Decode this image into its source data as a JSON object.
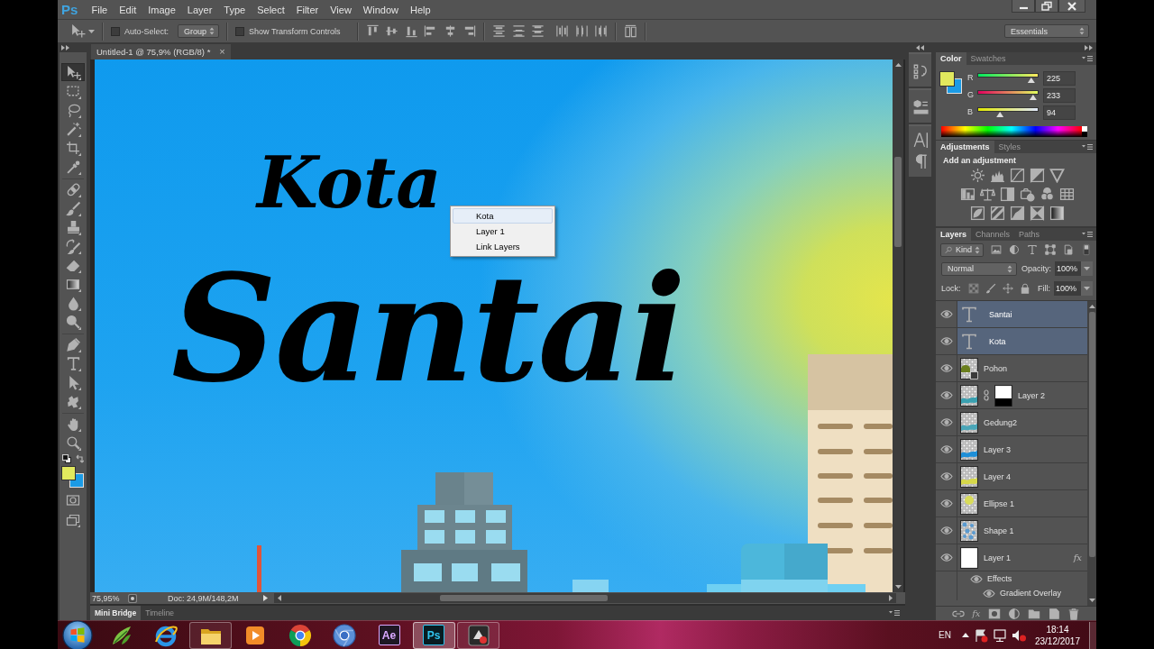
{
  "menubar": {
    "logo": "Ps",
    "items": [
      "File",
      "Edit",
      "Image",
      "Layer",
      "Type",
      "Select",
      "Filter",
      "View",
      "Window",
      "Help"
    ]
  },
  "options_bar": {
    "auto_select": {
      "label": "Auto-Select:",
      "checked": false
    },
    "target": "Group",
    "transform_controls": {
      "label": "Show Transform Controls",
      "checked": false
    },
    "workspace": "Essentials"
  },
  "toolbar": {
    "tools": [
      {
        "kind": "move",
        "selected": true
      },
      {
        "kind": "marquee",
        "selected": false
      },
      {
        "kind": "lasso",
        "selected": false
      },
      {
        "kind": "wand",
        "selected": false
      },
      {
        "kind": "crop",
        "selected": false
      },
      {
        "kind": "eyedropper",
        "selected": false
      },
      {
        "kind": "healing",
        "selected": false
      },
      {
        "kind": "brush",
        "selected": false
      },
      {
        "kind": "stamp",
        "selected": false
      },
      {
        "kind": "history",
        "selected": false
      },
      {
        "kind": "eraser",
        "selected": false
      },
      {
        "kind": "gradient",
        "selected": false
      },
      {
        "kind": "blur",
        "selected": false
      },
      {
        "kind": "dodge",
        "selected": false
      },
      {
        "kind": "pen",
        "selected": false
      },
      {
        "kind": "type",
        "selected": false
      },
      {
        "kind": "path",
        "selected": false
      },
      {
        "kind": "shape",
        "selected": false
      },
      {
        "kind": "hand",
        "selected": false
      },
      {
        "kind": "zoom",
        "selected": false
      }
    ]
  },
  "document": {
    "tab_title": "Untitled-1 @ 75,9% (RGB/8) *",
    "close": "×",
    "small_headline": "Kota",
    "large_headline": "Santai"
  },
  "context_menu": [
    {
      "label": "Kota",
      "selected": true
    },
    {
      "label": "Layer 1",
      "selected": false
    },
    {
      "label": "Link Layers",
      "selected": false
    }
  ],
  "status_bar": {
    "zoom": "75,95%",
    "doc_size": "Doc: 24,9M/148,2M"
  },
  "bottom_tabs": [
    {
      "label": "Mini Bridge",
      "selected": true
    },
    {
      "label": "Timeline",
      "selected": false
    }
  ],
  "color_panel": {
    "tabs": [
      {
        "label": "Color",
        "selected": true
      },
      {
        "label": "Swatches",
        "selected": false
      }
    ],
    "channels": [
      {
        "label": "R",
        "value": "225",
        "level": 0.88
      },
      {
        "label": "G",
        "value": "233",
        "level": 0.91
      },
      {
        "label": "B",
        "value": "94",
        "level": 0.37
      }
    ]
  },
  "adjustments_panel": {
    "tabs": [
      {
        "label": "Adjustments",
        "selected": true
      },
      {
        "label": "Styles",
        "selected": false
      }
    ],
    "heading": "Add an adjustment"
  },
  "layers_panel": {
    "tabs": [
      {
        "label": "Layers",
        "selected": true
      },
      {
        "label": "Channels",
        "selected": false
      },
      {
        "label": "Paths",
        "selected": false
      }
    ],
    "filter": "Kind",
    "blend_mode": "Normal",
    "opacity_label": "Opacity:",
    "opacity": "100%",
    "lock_label": "Lock:",
    "fill_label": "Fill:",
    "fill": "100%",
    "footer_fx": "fx",
    "layers": [
      {
        "name": "Santai",
        "kind": "text",
        "visible": true,
        "selected": true
      },
      {
        "name": "Kota",
        "kind": "text",
        "visible": true,
        "selected": true
      },
      {
        "name": "Pohon",
        "kind": "smart",
        "color": "#6b7f1e",
        "visible": true,
        "selected": false
      },
      {
        "name": "Layer 2",
        "kind": "masked",
        "color": "#3aa0b0",
        "visible": true,
        "selected": false
      },
      {
        "name": "Gedung2",
        "kind": "pixel",
        "color": "#4aa6b8",
        "visible": true,
        "selected": false
      },
      {
        "name": "Layer 3",
        "kind": "pixel",
        "color": "#1e8fd8",
        "visible": true,
        "selected": false
      },
      {
        "name": "Layer 4",
        "kind": "pixel",
        "color": "#d6d84a",
        "visible": true,
        "selected": false
      },
      {
        "name": "Ellipse 1",
        "kind": "ellipse",
        "color": "#d9dc5a",
        "visible": true,
        "selected": false
      },
      {
        "name": "Shape 1",
        "kind": "shape",
        "color": "#5a9ad0",
        "visible": true,
        "selected": false
      },
      {
        "name": "Layer 1",
        "kind": "fill",
        "color": "#ffffff",
        "badge": "fx",
        "visible": true,
        "selected": false,
        "children": [
          {
            "name": "Effects",
            "visible": true,
            "children": [
              {
                "name": "Gradient Overlay",
                "visible": true
              }
            ]
          }
        ]
      }
    ]
  },
  "taskbar": {
    "apps": [
      {
        "kind": "sprout",
        "running": false,
        "selected": false
      },
      {
        "kind": "browser",
        "running": false,
        "selected": false
      },
      {
        "kind": "folder",
        "running": true,
        "selected": false
      },
      {
        "kind": "player",
        "running": false,
        "selected": false
      },
      {
        "kind": "chrome",
        "running": false,
        "selected": false
      },
      {
        "kind": "chromium",
        "running": false,
        "selected": false
      },
      {
        "kind": "badge",
        "label": "Ae",
        "color": "#d9a9ff",
        "running": false,
        "selected": false
      },
      {
        "kind": "badge",
        "label": "Ps",
        "color": "#31c5f0",
        "running": true,
        "selected": true
      },
      {
        "kind": "tool",
        "running": true,
        "selected": false
      }
    ],
    "language": "EN",
    "time": "18:14",
    "date": "23/12/2017"
  }
}
